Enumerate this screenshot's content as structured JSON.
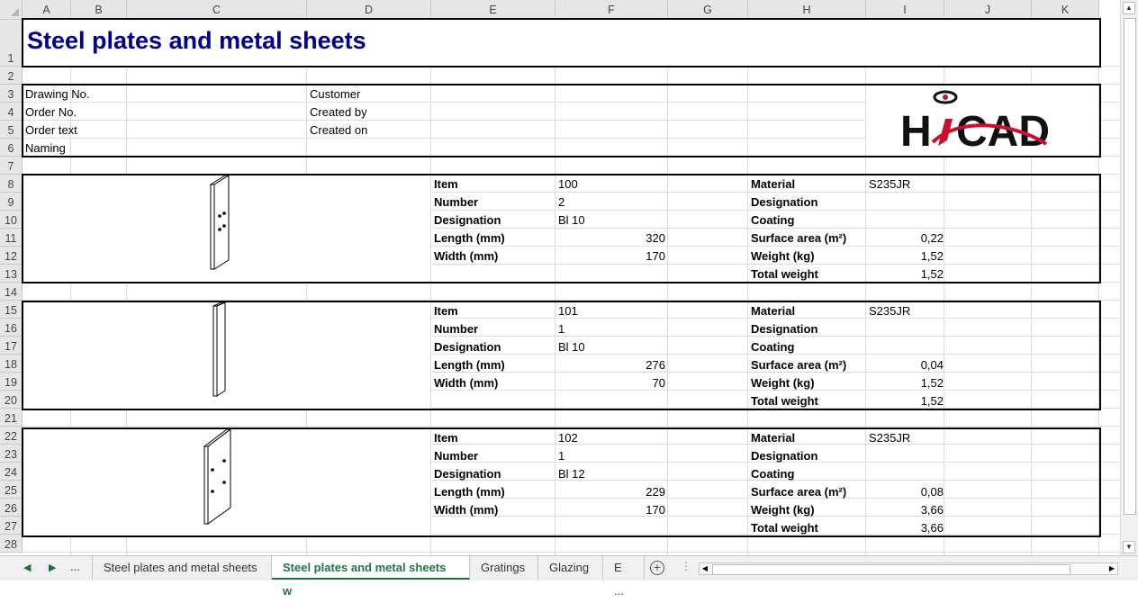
{
  "columns": [
    "A",
    "B",
    "C",
    "D",
    "E",
    "F",
    "G",
    "H",
    "I",
    "J",
    "K"
  ],
  "rows": [
    "1",
    "2",
    "3",
    "4",
    "5",
    "6",
    "7",
    "8",
    "9",
    "10",
    "11",
    "12",
    "13",
    "14",
    "15",
    "16",
    "17",
    "18",
    "19",
    "20",
    "21",
    "22",
    "23",
    "24",
    "25",
    "26",
    "27",
    "28"
  ],
  "title": "Steel plates and metal sheets",
  "header": {
    "drawing_no": "Drawing No.",
    "order_no": "Order No.",
    "order_text": "Order text",
    "naming": "Naming",
    "customer": "Customer",
    "created_by": "Created by",
    "created_on": "Created on"
  },
  "logo": {
    "text": "HiCAD",
    "accent": "#c8102e"
  },
  "labels": {
    "item": "Item",
    "number": "Number",
    "designation": "Designation",
    "length": "Length (mm)",
    "width": "Width (mm)",
    "material": "Material",
    "designation2": "Designation",
    "coating": "Coating",
    "surface": "Surface area (m²)",
    "weight": "Weight (kg)",
    "total_weight": "Total weight"
  },
  "items": [
    {
      "item": "100",
      "number": "2",
      "designation": "Bl 10",
      "length": "320",
      "width": "170",
      "material": "S235JR",
      "surface": "0,22",
      "weight": "1,52",
      "total_weight": "1,52"
    },
    {
      "item": "101",
      "number": "1",
      "designation": "Bl 10",
      "length": "276",
      "width": "70",
      "material": "S235JR",
      "surface": "0,04",
      "weight": "1,52",
      "total_weight": "1,52"
    },
    {
      "item": "102",
      "number": "1",
      "designation": "Bl 12",
      "length": "229",
      "width": "170",
      "material": "S235JR",
      "surface": "0,08",
      "weight": "3,66",
      "total_weight": "3,66"
    }
  ],
  "tabs": {
    "first": "Steel plates and metal sheets",
    "active": "Steel plates and metal sheets w",
    "third": "Gratings",
    "fourth": "Glazing",
    "fifth": "E ...",
    "more": "...",
    "add": "+"
  }
}
